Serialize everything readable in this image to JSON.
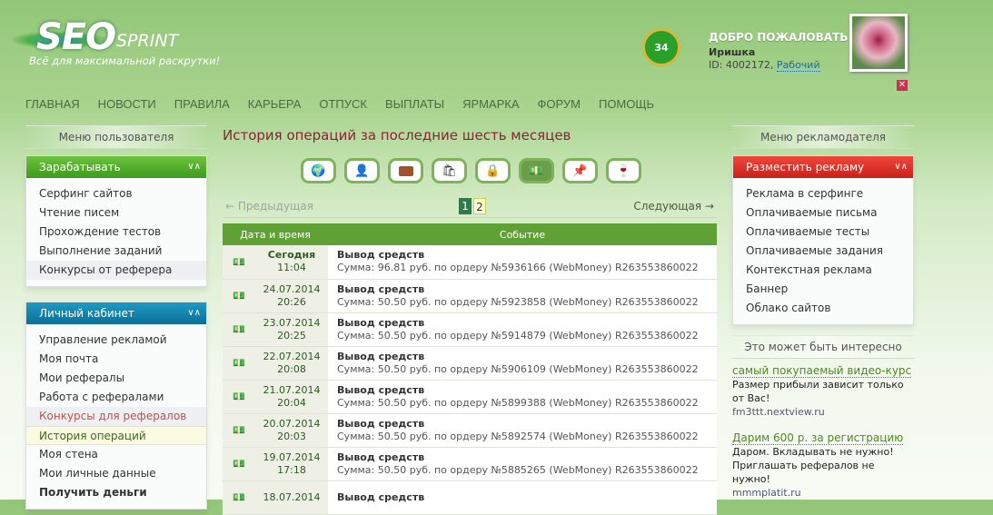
{
  "header": {
    "logo_main": "SEO",
    "logo_sub": "SPRINT",
    "slogan": "Всё для максимальной раскрутки!",
    "level": "34",
    "welcome": "ДОБРО ПОЖАЛОВАТЬ",
    "username": "Иришка",
    "user_id": "ID: 4002172,",
    "status": "Рабочий",
    "close": "✕"
  },
  "nav": [
    "ГЛАВНАЯ",
    "НОВОСТИ",
    "ПРАВИЛА",
    "КАРЬЕРА",
    "ОТПУСК",
    "ВЫПЛАТЫ",
    "ЯРМАРКА",
    "ФОРУМ",
    "ПОМОЩЬ"
  ],
  "left": {
    "title": "Меню пользователя",
    "earn": {
      "label": "Зарабатывать",
      "items": [
        "Серфинг сайтов",
        "Чтение писем",
        "Прохождение тестов",
        "Выполнение заданий",
        "Конкурсы от реферера"
      ]
    },
    "cabinet": {
      "label": "Личный кабинет",
      "items": [
        "Управление рекламой",
        "Моя почта",
        "Мои рефералы",
        "Работа с рефералами",
        "Конкурсы для рефералов",
        "История операций",
        "Моя стена",
        "Мои личные данные",
        "Получить деньги"
      ]
    }
  },
  "main": {
    "title": "История операций за последние шесть месяцев",
    "icons": [
      "globe-icon",
      "user-icon",
      "wallet-icon",
      "shopping-bag-icon",
      "lock-edit-icon",
      "money-icon",
      "pushpin-icon",
      "wine-glass-icon"
    ],
    "prev": "← Предыдущая",
    "next": "Следующая →",
    "pages": [
      "1",
      "2"
    ],
    "columns": [
      "Дата и время",
      "Событие"
    ],
    "rows": [
      {
        "date": "Сегодня",
        "time": "11:04",
        "event": "Вывод средств",
        "details": "Сумма: 96.81 руб. по ордеру №5936166 (WebMoney) R263553860022"
      },
      {
        "date": "24.07.2014",
        "time": "20:26",
        "event": "Вывод средств",
        "details": "Сумма: 50.50 руб. по ордеру №5923858 (WebMoney) R263553860022"
      },
      {
        "date": "23.07.2014",
        "time": "20:25",
        "event": "Вывод средств",
        "details": "Сумма: 50.50 руб. по ордеру №5914879 (WebMoney) R263553860022"
      },
      {
        "date": "22.07.2014",
        "time": "20:08",
        "event": "Вывод средств",
        "details": "Сумма: 50.50 руб. по ордеру №5906109 (WebMoney) R263553860022"
      },
      {
        "date": "21.07.2014",
        "time": "20:04",
        "event": "Вывод средств",
        "details": "Сумма: 50.50 руб. по ордеру №5899388 (WebMoney) R263553860022"
      },
      {
        "date": "20.07.2014",
        "time": "20:03",
        "event": "Вывод средств",
        "details": "Сумма: 50.50 руб. по ордеру №5892574 (WebMoney) R263553860022"
      },
      {
        "date": "19.07.2014",
        "time": "17:18",
        "event": "Вывод средств",
        "details": "Сумма: 50.50 руб. по ордеру №5885265 (WebMoney) R263553860022"
      },
      {
        "date": "18.07.2014",
        "time": "",
        "event": "Вывод средств",
        "details": ""
      }
    ]
  },
  "right": {
    "title": "Меню рекламодателя",
    "ads": {
      "label": "Разместить рекламу",
      "items": [
        "Реклама в серфинге",
        "Оплачиваемые письма",
        "Оплачиваемые тесты",
        "Оплачиваемые задания",
        "Контекстная реклама",
        "Баннер",
        "Облако сайтов"
      ]
    },
    "interest": {
      "title": "Это может быть интересно",
      "items": [
        {
          "link": "самый покупаемый видео-курс",
          "desc": "Размер прибыли зависит только от Вас!",
          "url": "fm3ttt.nextview.ru"
        },
        {
          "link": "Дарим 600 р. за регистрацию",
          "desc": "Даром. Вкладывать не нужно! Приглашать рефералов не нужно!",
          "url": "mmmplatit.ru"
        }
      ]
    }
  }
}
